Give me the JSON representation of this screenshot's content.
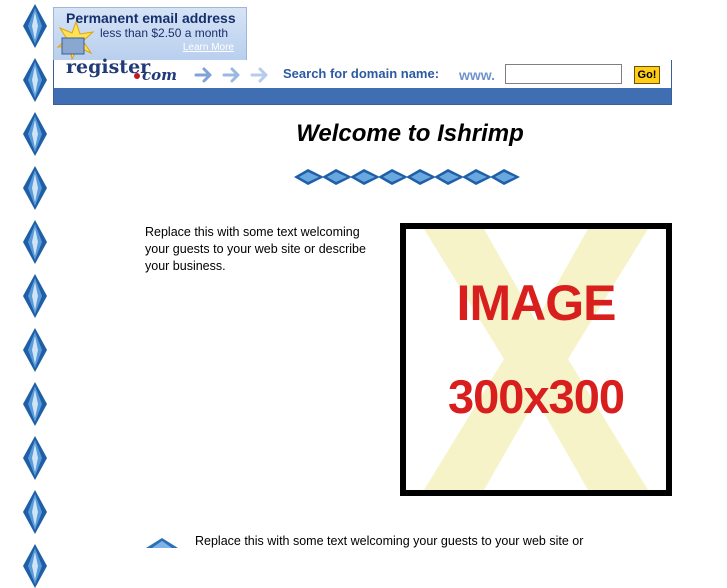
{
  "banner": {
    "title": "Permanent email address",
    "subtitle": "less than $2.50 a month",
    "link": "Learn More"
  },
  "search_bar": {
    "logo_register": "register",
    "logo_com": "com",
    "label": "Search for domain name:",
    "prefix": "www.",
    "input_value": "",
    "go_label": "Go!"
  },
  "main": {
    "title": "Welcome to Ishrimp",
    "intro": "Replace this with some text welcoming your guests to your web site or describe your business.",
    "image_placeholder": {
      "line1": "IMAGE",
      "line2": "300x300"
    },
    "bottom_text": "Replace this with some text welcoming your guests to your web site or"
  },
  "colors": {
    "gem": "#2b6fb6",
    "brand_dark": "#213a78",
    "bar_band": "#3f6eb2",
    "go_button": "#ffcc1a",
    "image_text": "#d91e1e",
    "image_x": "#f6f3c8"
  },
  "icons": {
    "side_gem": "blue-diamond-gem-icon",
    "divider_gem": "horizontal-blue-gem-icon",
    "star": "starburst-icon",
    "arrow": "right-arrow-icon"
  }
}
